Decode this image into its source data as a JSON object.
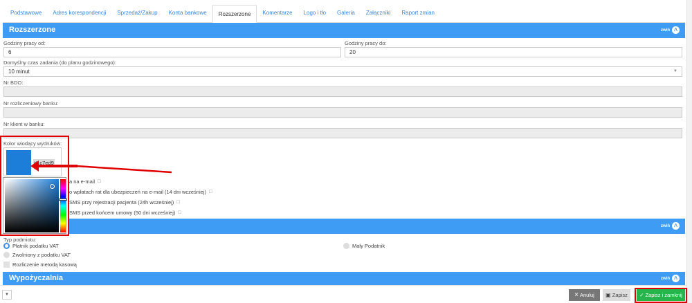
{
  "tabs": [
    {
      "label": "Podstawowe",
      "active": false
    },
    {
      "label": "Adres korespondencji",
      "active": false
    },
    {
      "label": "Sprzedaż/Zakup",
      "active": false
    },
    {
      "label": "Konta bankowe",
      "active": false
    },
    {
      "label": "Rozszerzone",
      "active": true
    },
    {
      "label": "Komentarze",
      "active": false
    },
    {
      "label": "Logo i tło",
      "active": false
    },
    {
      "label": "Galeria",
      "active": false
    },
    {
      "label": "Załączniki",
      "active": false
    },
    {
      "label": "Raport zmian",
      "active": false
    }
  ],
  "section_rozszerzone": {
    "title": "Rozszerzone",
    "toggle": "zwiń"
  },
  "fields": {
    "hours_from_label": "Godziny pracy od:",
    "hours_from_value": "6",
    "hours_to_label": "Godziny pracy do:",
    "hours_to_value": "20",
    "task_time_label": "Domyślny czas zadania (do planu godzinowego):",
    "task_time_value": "10 minut",
    "bdo_label": "Nr BDO:",
    "bank_account_label": "Nr rozliczeniowy banku:",
    "bank_client_label": "Nr klient w banku:",
    "color_label": "Kolor wiodący wydruków:",
    "color_value": "#1c7ed9"
  },
  "notifications": [
    "a na e-mail",
    "o wpłatach rat dla ubezpieczeń na e-mail (14 dni wcześniej)",
    "SMS przy rejestracji pacjenta (24h wcześniej)",
    "SMS przed końcem umowy (50 dni wcześniej)"
  ],
  "section_second": {
    "toggle": "zwiń"
  },
  "tax": {
    "type_label": "Typ podmiotu:",
    "option_vat": "Płatnik podatku VAT",
    "option_small": "Mały Podatnik",
    "option_exempt": "Zwolniony z podatku VAT",
    "cash_method": "Rozliczenie metodą kasową"
  },
  "section_wypozyczalnia": {
    "title": "Wypożyczalnia",
    "toggle": "zwiń"
  },
  "footer": {
    "cancel": "Anuluj",
    "save": "Zapisz",
    "save_close": "Zapisz i zamknij"
  },
  "colors": {
    "accent": "#3f9cf5",
    "selected_color": "#1c7ed9",
    "highlight": "#e00000",
    "success": "#26b54b"
  }
}
